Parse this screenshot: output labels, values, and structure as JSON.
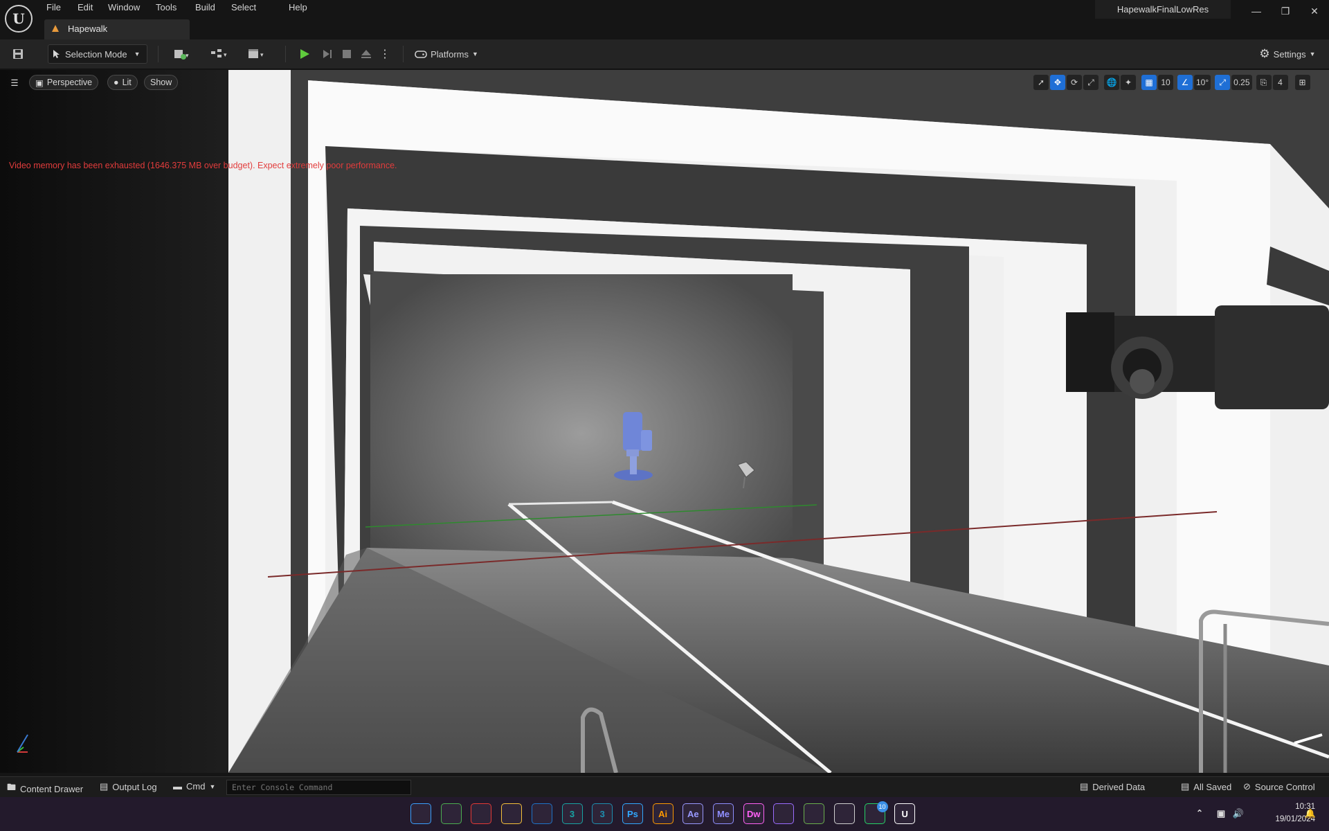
{
  "menu": {
    "items": [
      "File",
      "Edit",
      "Window",
      "Tools",
      "Build",
      "Select",
      "Help"
    ]
  },
  "project": {
    "name": "HapewalkFinalLowRes"
  },
  "level_tab": {
    "label": "Hapewalk"
  },
  "toolbar": {
    "selection_mode": "Selection Mode",
    "platforms": "Platforms",
    "settings": "Settings"
  },
  "viewport": {
    "perspective": "Perspective",
    "lit": "Lit",
    "show": "Show",
    "warning": "Video memory has been exhausted (1646.375 MB over budget). Expect extremely poor performance.",
    "grid_snap": "10",
    "rotation_snap": "10°",
    "scale_snap": "0.25",
    "camera_speed": "4"
  },
  "statusbar": {
    "content_drawer": "Content Drawer",
    "output_log": "Output Log",
    "cmd": "Cmd",
    "console_placeholder": "Enter Console Command",
    "derived_data": "Derived Data",
    "all_saved": "All Saved",
    "source_control": "Source Control"
  },
  "taskbar": {
    "apps": [
      {
        "icon": "windows-start-icon",
        "label": "",
        "color": "#3aa0ff"
      },
      {
        "icon": "chrome-beta-icon",
        "label": "",
        "color": "#4caf50"
      },
      {
        "icon": "chrome-icon",
        "label": "",
        "color": "#e53935"
      },
      {
        "icon": "file-explorer-icon",
        "label": "",
        "color": "#f5c03a"
      },
      {
        "icon": "outlook-icon",
        "label": "",
        "color": "#1e73c8"
      },
      {
        "icon": "3dsmax-icon",
        "label": "3",
        "color": "#17a4a4"
      },
      {
        "icon": "3dsmax-alt-icon",
        "label": "3",
        "color": "#1d8fb0"
      },
      {
        "icon": "photoshop-icon",
        "label": "Ps",
        "color": "#31a8ff"
      },
      {
        "icon": "illustrator-icon",
        "label": "Ai",
        "color": "#ff9a00"
      },
      {
        "icon": "after-effects-icon",
        "label": "Ae",
        "color": "#9999ff"
      },
      {
        "icon": "media-encoder-icon",
        "label": "Me",
        "color": "#8f8fff"
      },
      {
        "icon": "dreamweaver-icon",
        "label": "Dw",
        "color": "#ff61f6"
      },
      {
        "icon": "lightbulb-app-icon",
        "label": "",
        "color": "#9b6cff"
      },
      {
        "icon": "vectorworks-icon",
        "label": "",
        "color": "#6ab04c"
      },
      {
        "icon": "davinci-icon",
        "label": "",
        "color": "#cfcfcf"
      },
      {
        "icon": "whatsapp-icon",
        "label": "",
        "color": "#25d366"
      },
      {
        "icon": "unreal-engine-icon",
        "label": "U",
        "color": "#ffffff"
      }
    ],
    "whatsapp_badge": "10",
    "time": "10:31",
    "date": "19/01/2024"
  }
}
